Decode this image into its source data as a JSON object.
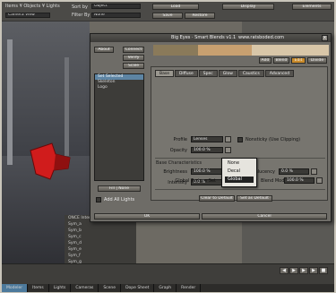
{
  "host_toolbar": {
    "menu_left": "Items ¥ Objects ¥ Lights",
    "camera_label": "Camera View",
    "sort_by_label": "Sort by",
    "sort_by_value": "Object",
    "filter_by_label": "Filter By",
    "filter_by_value": "None",
    "load_label": "Load",
    "save_label": "Save",
    "restore_label": "Restore",
    "display_label": "Display",
    "top_right_label": "Elements"
  },
  "dialog": {
    "title": "Big Eyes · Smart Blends v1.1",
    "url": "www.ratsboded.com",
    "close_label": "x",
    "about_label": "About",
    "connect_label": "Connect",
    "verify_label": "Verify",
    "fill_label": "Fill",
    "scale_label": "Scale",
    "clear_label": "Clear",
    "items": [
      "Set Selected",
      "Skeleton",
      "Logo"
    ],
    "footer_left": "Fill | None",
    "add_all_label": "Add All Lights",
    "ok_label": "OK",
    "cancel_label": "Cancel",
    "action_buttons": [
      "Add",
      "Blend",
      "Edit",
      "Divide"
    ],
    "tabs": [
      "Base",
      "Diffuse",
      "Spec",
      "Glow",
      "Caustics",
      "Advanced"
    ],
    "active_tab": "Base",
    "section_label": "Base Characteristics",
    "fields": {
      "profile_label": "Profile",
      "profile_value": "Lenses",
      "opacity_label": "Opacity",
      "opacity_value": "100.0 %",
      "nonsticky_label": "Nonsticky (Use Clipping)",
      "brightness_label": "Brightness",
      "brightness_value": "100.0 %",
      "translucency_label": "Translucency",
      "translucency_value": "0.0 %",
      "intensity_label": "Intensity",
      "intensity_value": "0.0 %",
      "blend_mode_label": "Blend Mode",
      "blend_mode_value": "100.0 %",
      "texture_label": "Global Texture Set"
    },
    "clear_to_default_label": "Clear to Default",
    "set_as_default_label": "Set as Default",
    "popup_options": [
      "None",
      "Decal",
      "Global"
    ],
    "popup_selected": "Global"
  },
  "scene_list": [
    "ONCE Interaction",
    "Sym_a",
    "Sym_b",
    "Sym_c",
    "Sym_d",
    "Sym_e",
    "Sym_f",
    "Sym_g"
  ],
  "bottom_tabs": [
    "Modeler",
    "Items",
    "Lights",
    "Cameras",
    "Scene",
    "Dope Sheet",
    "Graph",
    "Render"
  ],
  "bottom_active_tab": "Modeler",
  "colors": {
    "swatch_1": "#8a7a5a",
    "swatch_2": "#c8a070",
    "swatch_3": "#d8c6a8",
    "accent_blue": "#5d84a3",
    "viewport_red": "#d01c1c"
  }
}
